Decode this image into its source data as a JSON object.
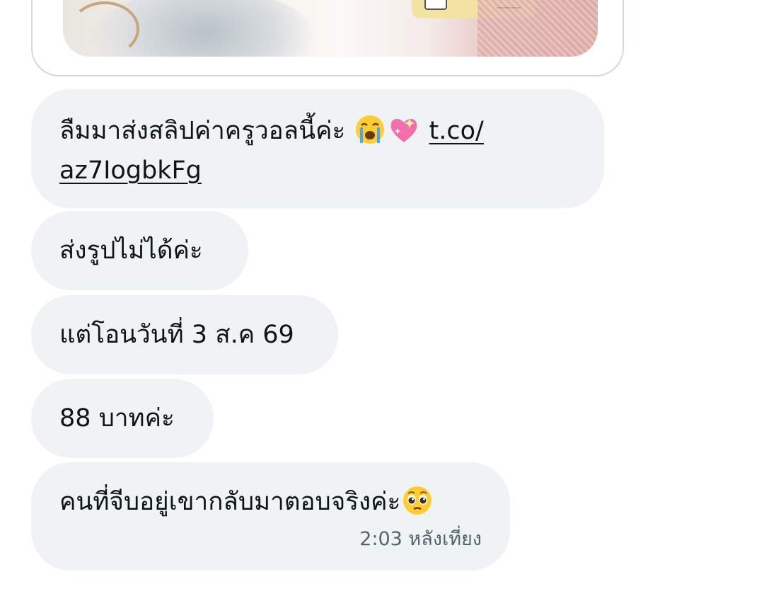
{
  "messages": [
    {
      "text": "ลืมมาส่งสลิปค่าครูวอลนี้ค่ะ",
      "emojis": [
        "loudly-crying-face-icon",
        "sparkling-heart-icon"
      ],
      "link": "t.co/ az7IogbkFg",
      "link_line1": "t.co/",
      "link_line2": "az7IogbkFg"
    },
    {
      "text": "ส่งรูปไม่ได้ค่ะ"
    },
    {
      "text": "แต่โอนวันที่ 3 ส.ค 69"
    },
    {
      "text": "88 บาทค่ะ"
    },
    {
      "text": "คนที่จีบอยู่เขากลับมาตอบจริงค่ะ",
      "emojis": [
        "pleading-face-icon"
      ],
      "timestamp": "2:03 หลังเที่ยง"
    }
  ],
  "colors": {
    "bubble_bg": "#eff3f4",
    "text": "#0f1419",
    "timestamp": "#536471",
    "card_border": "#cfd9de"
  }
}
